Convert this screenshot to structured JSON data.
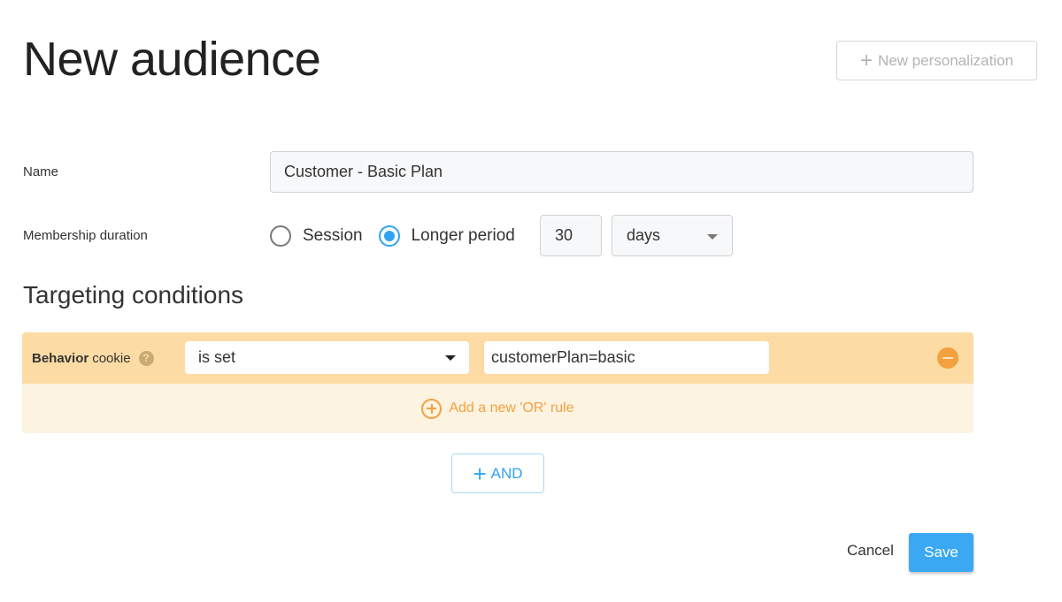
{
  "page": {
    "title": "New audience"
  },
  "header": {
    "new_personalization_label": "New personalization",
    "plus_icon": "plus-icon"
  },
  "form": {
    "name_label": "Name",
    "name_value": "Customer - Basic Plan",
    "membership_label": "Membership duration",
    "duration_options": [
      {
        "label": "Session",
        "checked": false
      },
      {
        "label": "Longer period",
        "checked": true
      }
    ],
    "duration_value": "30",
    "duration_unit": "days"
  },
  "targeting": {
    "title": "Targeting conditions",
    "conditions": [
      {
        "type_bold": "Behavior",
        "type_rest": "cookie",
        "help_icon": "?",
        "operator": "is set",
        "value": "customerPlan=basic"
      }
    ],
    "add_or_label": "Add a new 'OR' rule",
    "and_label": "AND"
  },
  "footer": {
    "cancel_label": "Cancel",
    "save_label": "Save"
  },
  "colors": {
    "accent_blue": "#3aa8f2",
    "condition_orange": "#fcdca4",
    "or_row_bg": "#fdf3e1",
    "orange_icon": "#f4a03e"
  }
}
